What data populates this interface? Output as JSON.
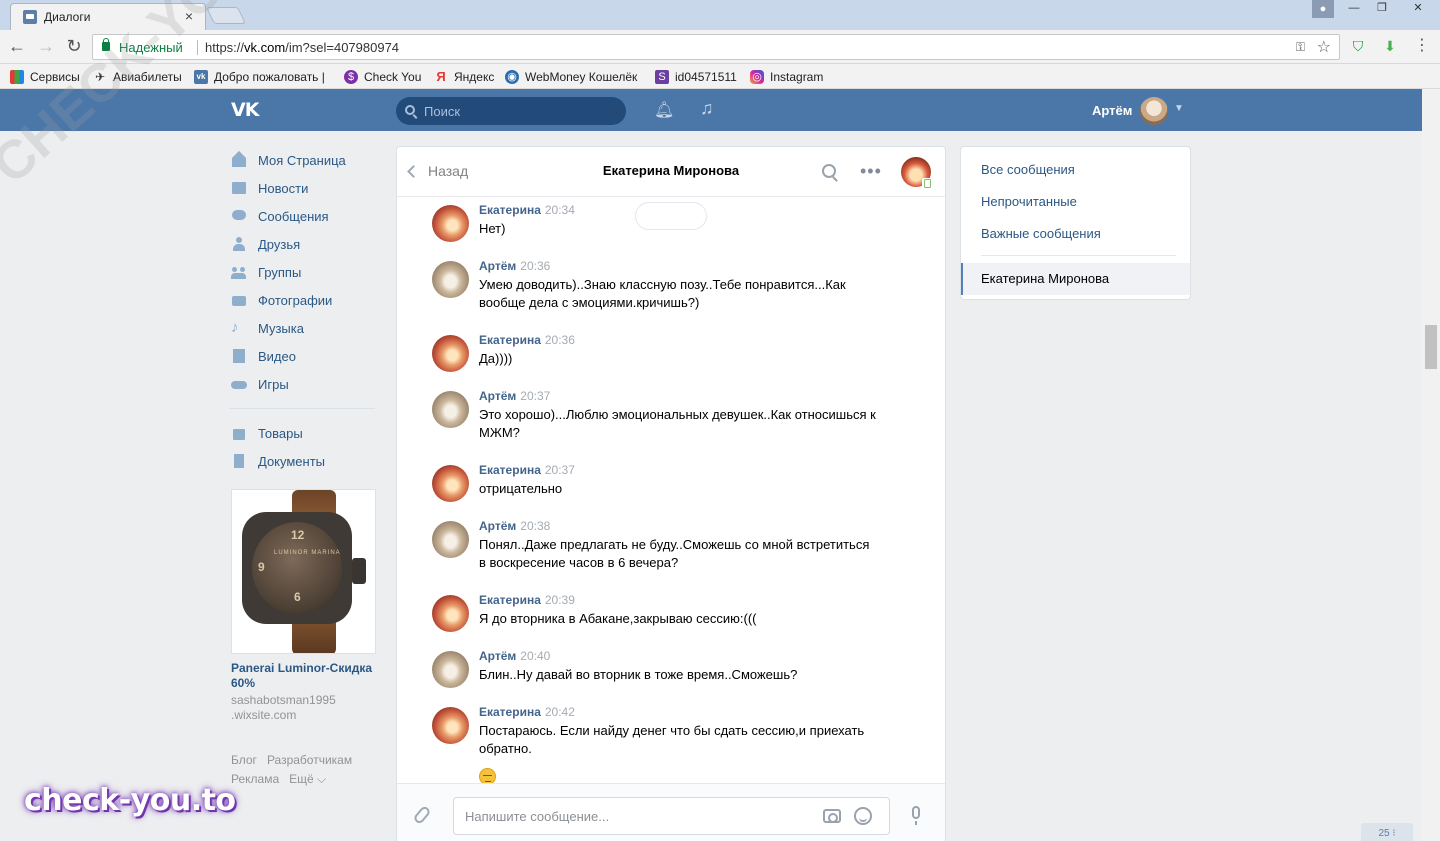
{
  "browser": {
    "tab_title": "Диалоги",
    "tab_close": "×",
    "secure_label": "Надежный",
    "url_scheme": "https://",
    "url_host": "vk.com",
    "url_path": "/im?sel=407980974",
    "window_buttons": [
      "—",
      "❐",
      "✕"
    ],
    "bookmarks": [
      {
        "label": "Сервисы",
        "icon": "apps-grid-icon"
      },
      {
        "label": "Авиабилеты",
        "icon": "plane-icon"
      },
      {
        "label": "Добро пожаловать |",
        "icon": "vk-icon"
      },
      {
        "label": "Check You",
        "icon": "checkyou-icon"
      },
      {
        "label": "Яндекс",
        "icon": "yandex-icon"
      },
      {
        "label": "WebMoney Кошелёк",
        "icon": "webmoney-icon"
      },
      {
        "label": "id04571511",
        "icon": "s-icon"
      },
      {
        "label": "Instagram",
        "icon": "instagram-icon"
      }
    ]
  },
  "vk_header": {
    "logo": "VK",
    "search_placeholder": "Поиск",
    "user_name": "Артём"
  },
  "left_menu": {
    "items": [
      {
        "label": "Моя Страница",
        "icon": "home-icon"
      },
      {
        "label": "Новости",
        "icon": "news-icon"
      },
      {
        "label": "Сообщения",
        "icon": "messages-icon"
      },
      {
        "label": "Друзья",
        "icon": "friends-icon"
      },
      {
        "label": "Группы",
        "icon": "groups-icon"
      },
      {
        "label": "Фотографии",
        "icon": "camera-icon"
      },
      {
        "label": "Музыка",
        "icon": "music-icon"
      },
      {
        "label": "Видео",
        "icon": "video-icon"
      },
      {
        "label": "Игры",
        "icon": "gamepad-icon"
      }
    ],
    "items2": [
      {
        "label": "Товары",
        "icon": "bag-icon"
      },
      {
        "label": "Документы",
        "icon": "document-icon"
      }
    ]
  },
  "ad": {
    "title": "Panerai Luminor-Скидка 60%",
    "site": "sashabotsman1995 .wixsite.com",
    "dial_brand": "LUMINOR MARINA"
  },
  "footer_links": {
    "blog": "Блог",
    "developers": "Разработчикам",
    "ads": "Реклама",
    "more": "Ещё ⌵"
  },
  "watermark": "check-you.to",
  "diagonal_watermark": "CHECK-YOU.ME",
  "chat": {
    "back_label": "Назад",
    "peer_name": "Екатерина Миронова",
    "messages": [
      {
        "author": "Екатерина",
        "time": "20:34",
        "text": "Нет)",
        "who": "kat"
      },
      {
        "author": "Артём",
        "time": "20:36",
        "text": "Умею доводить)..Знаю классную позу..Тебе понравится...Как вообще дела с эмоциями.кричишь?)",
        "who": "art"
      },
      {
        "author": "Екатерина",
        "time": "20:36",
        "text": "Да))))",
        "who": "kat"
      },
      {
        "author": "Артём",
        "time": "20:37",
        "text": "Это хорошо)...Люблю эмоциональных девушек..Как относишься к МЖМ?",
        "who": "art"
      },
      {
        "author": "Екатерина",
        "time": "20:37",
        "text": "отрицательно",
        "who": "kat"
      },
      {
        "author": "Артём",
        "time": "20:38",
        "text": "Понял..Даже предлагать не буду..Сможешь со мной встретиться в воскресение часов в 6 вечера?",
        "who": "art"
      },
      {
        "author": "Екатерина",
        "time": "20:39",
        "text": "Я до вторника в Абакане,закрываю сессию:(((",
        "who": "kat"
      },
      {
        "author": "Артём",
        "time": "20:40",
        "text": "Блин..Ну давай во вторник в тоже время..Сможешь?",
        "who": "art"
      },
      {
        "author": "Екатерина",
        "time": "20:42",
        "text": "Постараюсь. Если найду денег что бы сдать сессию,и приехать обратно.",
        "who": "kat"
      }
    ],
    "composer_placeholder": "Напишите сообщение..."
  },
  "right_panel": {
    "all": "Все сообщения",
    "unread": "Непрочитанные",
    "important": "Важные сообщения",
    "active_dialog": "Екатерина Миронова"
  },
  "corner_badge": "25 ⁝"
}
